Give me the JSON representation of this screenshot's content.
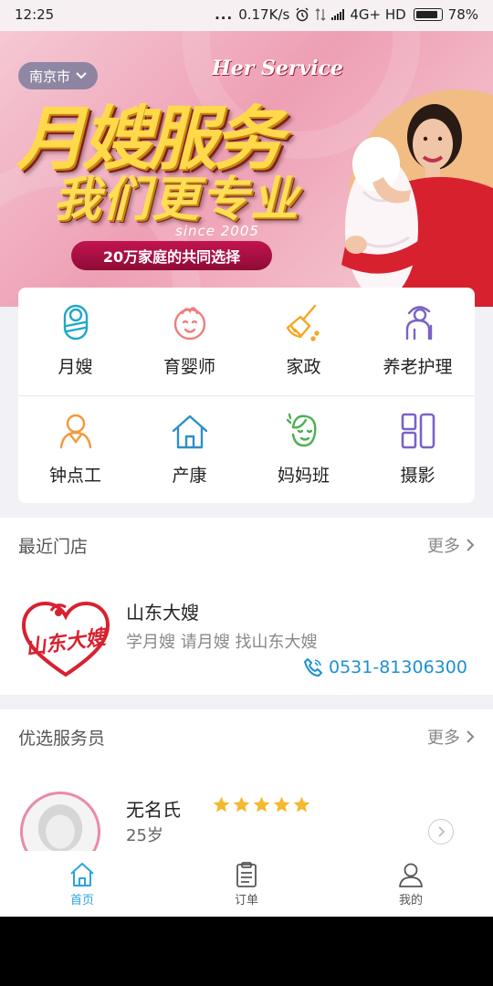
{
  "status_bar": {
    "time": "12:25",
    "dots": "...",
    "speed": "0.17K/s",
    "network": "4G+ HD",
    "battery": "78%"
  },
  "banner": {
    "city": "南京市",
    "english": "Her Service",
    "title": "月嫂服务",
    "subtitle": "我们更专业",
    "since": "since 2005",
    "pill": "20万家庭的共同选择",
    "slides": 3,
    "active_slide": 1
  },
  "services": [
    {
      "label": "月嫂",
      "icon": "baby-swaddle-icon",
      "color": "#1fa7c8"
    },
    {
      "label": "育婴师",
      "icon": "baby-face-icon",
      "color": "#ef7d7d"
    },
    {
      "label": "家政",
      "icon": "broom-icon",
      "color": "#f5a623"
    },
    {
      "label": "养老护理",
      "icon": "elderly-cane-icon",
      "color": "#7b61c8"
    },
    {
      "label": "钟点工",
      "icon": "person-icon",
      "color": "#f29a3c"
    },
    {
      "label": "产康",
      "icon": "house-icon",
      "color": "#2f8fc9"
    },
    {
      "label": "妈妈班",
      "icon": "woman-face-icon",
      "color": "#4caf50"
    },
    {
      "label": "摄影",
      "icon": "grid-blocks-icon",
      "color": "#7b61c8"
    }
  ],
  "store_section": {
    "title": "最近门店",
    "more": "更多",
    "logo_text": "山东大嫂",
    "name": "山东大嫂",
    "slogan": "学月嫂 请月嫂 找山东大嫂",
    "phone": "0531-81306300"
  },
  "staff_section": {
    "title": "优选服务员",
    "more": "更多",
    "name": "无名氏",
    "rating": 5,
    "age": "25岁"
  },
  "tabs": [
    {
      "label": "首页",
      "icon": "home-icon",
      "active": true
    },
    {
      "label": "订单",
      "icon": "clipboard-icon",
      "active": false
    },
    {
      "label": "我的",
      "icon": "user-icon",
      "active": false
    }
  ],
  "colors": {
    "accent": "#2ba3e0",
    "phone": "#1e90d0",
    "star": "#f5b92e",
    "brand_red": "#d8212f"
  }
}
